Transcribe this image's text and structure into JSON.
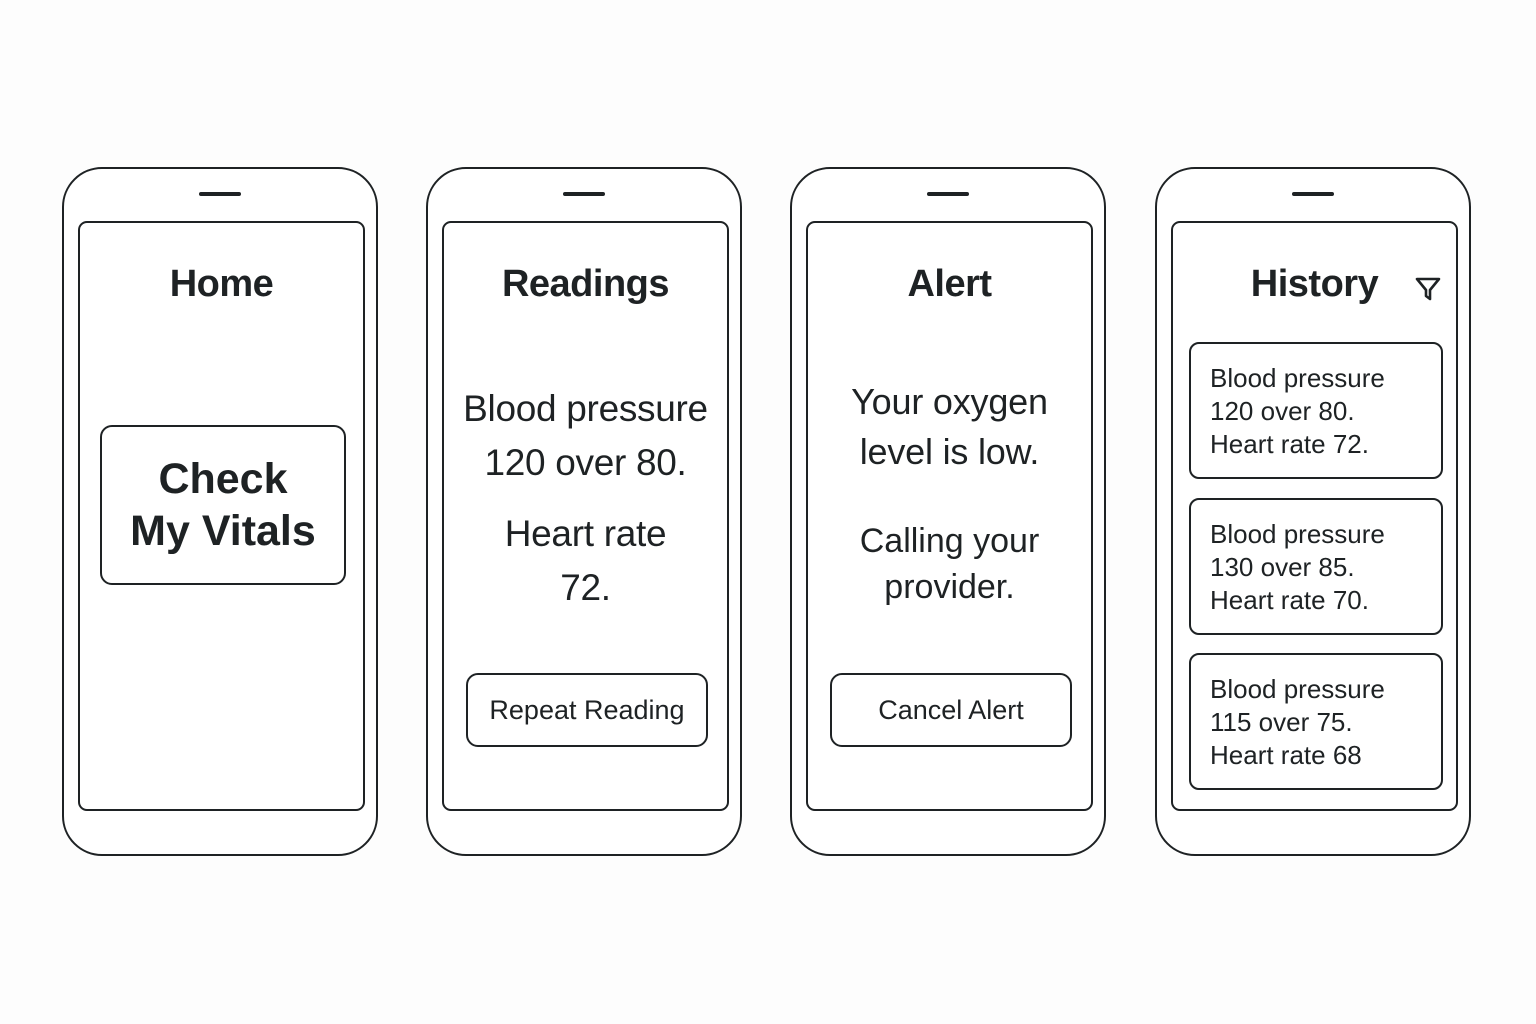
{
  "home": {
    "title": "Home",
    "check_button": {
      "line1": "Check",
      "line2": "My Vitals"
    }
  },
  "readings": {
    "title": "Readings",
    "bp_line1": "Blood pressure",
    "bp_line2": "120 over 80.",
    "hr_line1": "Heart rate",
    "hr_line2": "72.",
    "repeat_button": "Repeat Reading"
  },
  "alert": {
    "title": "Alert",
    "message_line1": "Your oxygen",
    "message_line2": "level is low.",
    "calling_line1": "Calling your",
    "calling_line2": "provider.",
    "cancel_button": "Cancel Alert"
  },
  "history": {
    "title": "History",
    "filter_icon": "filter-icon",
    "entries": [
      {
        "line1": "Blood pressure",
        "line2": "120 over 80.",
        "line3": "Heart rate 72."
      },
      {
        "line1": "Blood pressure",
        "line2": "130 over 85.",
        "line3": "Heart rate 70."
      },
      {
        "line1": "Blood pressure",
        "line2": "115 over 75.",
        "line3": "Heart rate 68"
      }
    ]
  }
}
